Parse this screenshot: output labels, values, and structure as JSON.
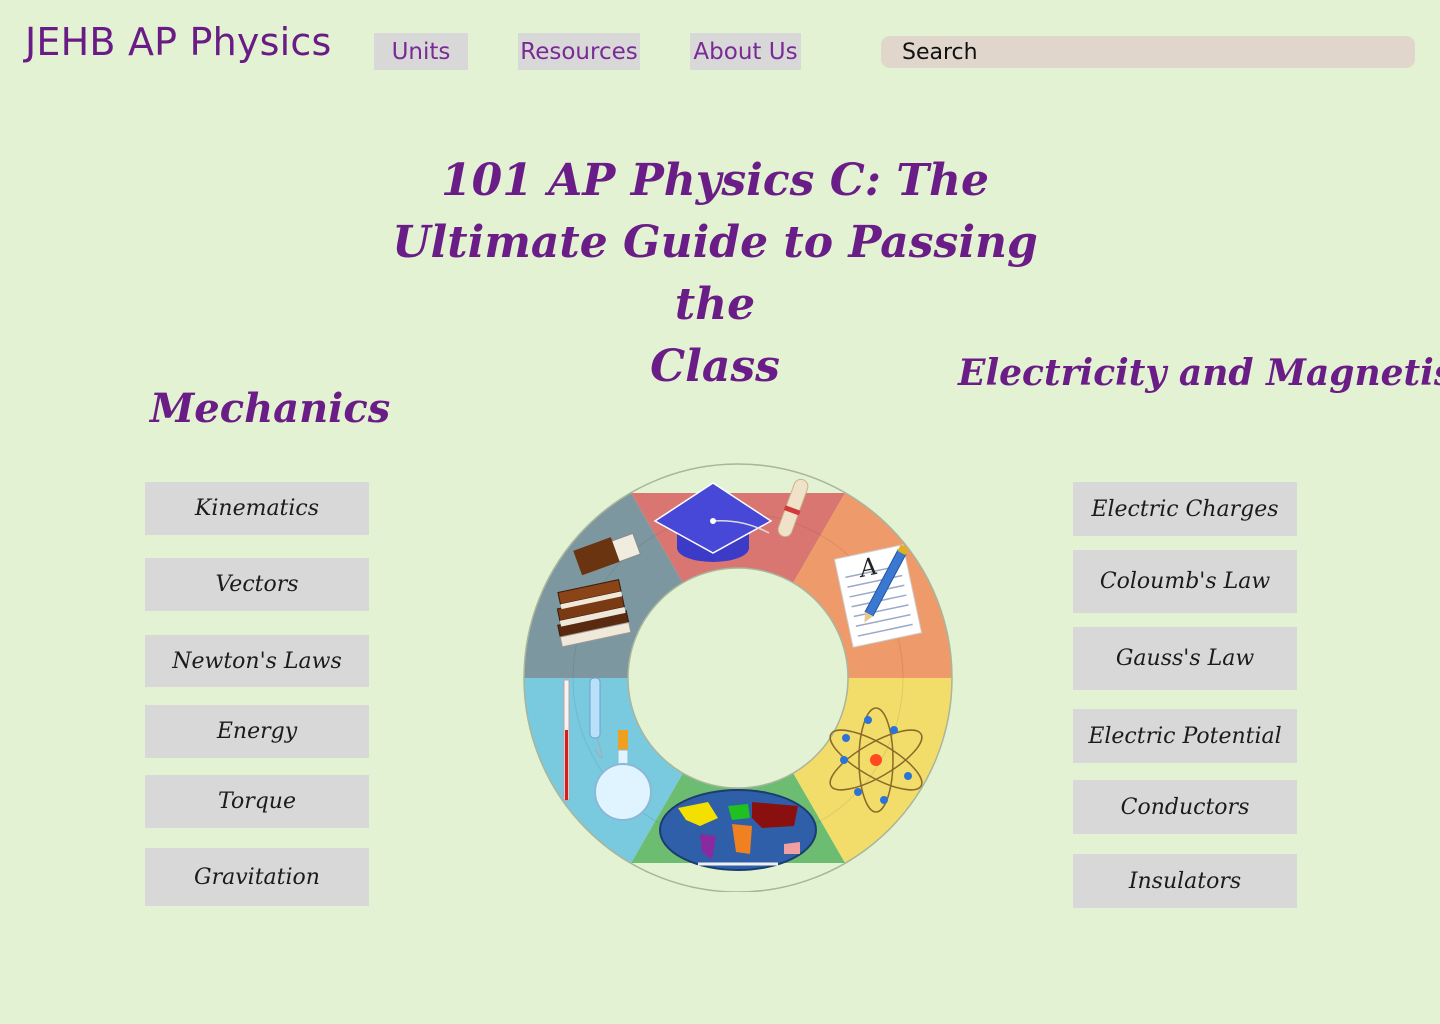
{
  "header": {
    "brand": "JEHB AP Physics",
    "nav": [
      {
        "label": "Units"
      },
      {
        "label": "Resources"
      },
      {
        "label": "About Us"
      }
    ],
    "search_placeholder": "Search"
  },
  "hero": {
    "title_lines": [
      "101 AP Physics C: The",
      "Ultimate Guide to Passing the",
      "Class"
    ]
  },
  "mechanics": {
    "title": "Mechanics",
    "topics": [
      "Kinematics",
      "Vectors",
      "Newton's Laws",
      "Energy",
      "Torque",
      "Gravitation"
    ]
  },
  "em": {
    "title": "Electricity and Magnetism",
    "topics": [
      "Electric Charges",
      "Coloumb's Law",
      "Gauss's Law",
      "Electric Potential",
      "Conductors",
      "Insulators"
    ]
  },
  "wheel": {
    "segments": [
      {
        "icon": "graduation-cap-icon",
        "color": "#d97672"
      },
      {
        "icon": "notepad-pencil-icon",
        "color": "#ee9a6a"
      },
      {
        "icon": "atom-icon",
        "color": "#f2dc6a"
      },
      {
        "icon": "world-map-icon",
        "color": "#6cbd72"
      },
      {
        "icon": "lab-flask-icon",
        "color": "#79c9df"
      },
      {
        "icon": "books-icon",
        "color": "#7d97a0"
      }
    ]
  },
  "colors": {
    "background": "#e2f2d2",
    "accent": "#6b1d87",
    "button": "#d8d8d8",
    "search": "#e0d6cc"
  }
}
